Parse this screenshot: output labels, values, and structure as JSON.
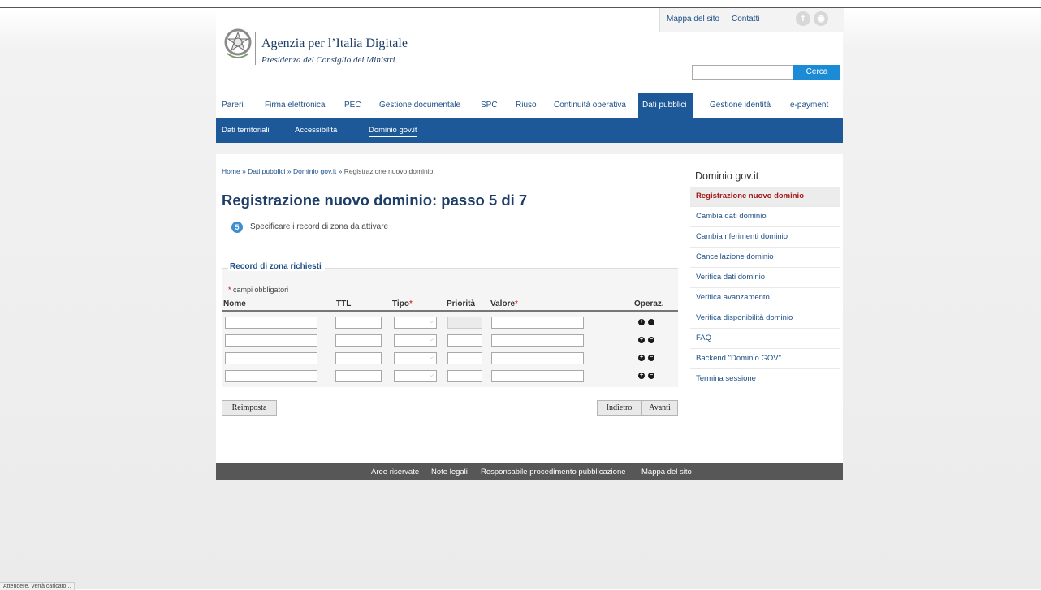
{
  "header": {
    "agency_name": "Agenzia per l’Italia Digitale",
    "agency_sub": "Presidenza del Consiglio dei Ministri",
    "top_links": [
      "Mappa del sito",
      "Contatti"
    ],
    "social": [
      "facebook-icon",
      "rss-icon"
    ],
    "search": {
      "placeholder": "",
      "button": "Cerca"
    }
  },
  "main_nav": [
    "Pareri",
    "Firma elettronica",
    "PEC",
    "Gestione documentale",
    "SPC",
    "Riuso",
    "Continuità operativa",
    "Dati pubblici",
    "Gestione identità",
    "e-payment"
  ],
  "main_nav_active": "Dati pubblici",
  "sub_nav": [
    "Dati territoriali",
    "Accessibilità",
    "Dominio gov.it"
  ],
  "sub_nav_active": "Dominio gov.it",
  "breadcrumb": {
    "items": [
      "Home",
      "Dati pubblici",
      "Dominio gov.it"
    ],
    "separator": "»",
    "current": "Registrazione nuovo dominio"
  },
  "page": {
    "title": "Registrazione nuovo dominio: passo 5 di 7",
    "step_number": "5",
    "step_text": "Specificare i record di zona da attivare"
  },
  "form": {
    "legend": "Record di zona richiesti",
    "required_note": "campi obbligatori",
    "required_mark": "*",
    "columns": {
      "nome": "Nome",
      "ttl": "TTL",
      "tipo": "Tipo",
      "priorita": "Priorità",
      "valore": "Valore",
      "operaz": "Operaz."
    },
    "row_count": 4,
    "buttons": {
      "reset": "Reimposta",
      "back": "Indietro",
      "next": "Avanti"
    }
  },
  "sidebar": {
    "title": "Dominio gov.it",
    "items": [
      "Registrazione nuovo dominio",
      "Cambia dati dominio",
      "Cambia riferimenti dominio",
      "Cancellazione dominio",
      "Verifica dati dominio",
      "Verifica avanzamento",
      "Verifica disponibilità dominio",
      "FAQ",
      "Backend \"Dominio GOV\"",
      "Termina sessione"
    ],
    "active": "Registrazione nuovo dominio"
  },
  "footer": {
    "links": [
      "Aree riservate",
      "Note legali",
      "Responsabile procedimento pubblicazione",
      "Mappa del sito"
    ]
  },
  "status_bar": "Attendere. Verrà caricato..."
}
